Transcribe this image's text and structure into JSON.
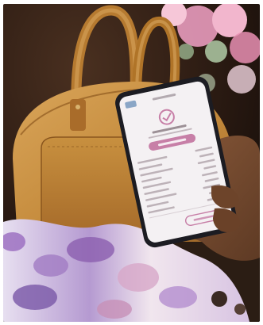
{
  "photo": {
    "scene": "hand-holding-phone-beside-handbag"
  },
  "phone_screen": {
    "app_icon": "brand-logo-icon",
    "status_icon": "checkmark-circle-icon"
  },
  "colors": {
    "handbag": "#c48a3b",
    "accent_button": "#c77fa7",
    "phone_body": "#1c1c22",
    "screen": "#f4f1f3",
    "flowers": "#e89bbc",
    "scarf_purple": "#8c5fb0"
  }
}
